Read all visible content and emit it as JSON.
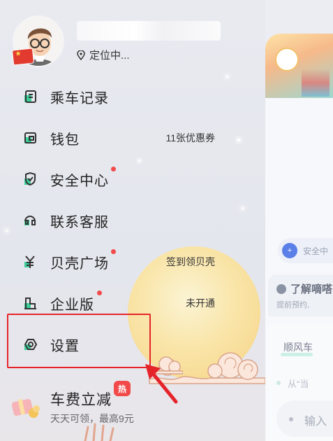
{
  "profile": {
    "location_text": "定位中..."
  },
  "menu": {
    "items": [
      {
        "label": "乘车记录",
        "extra": "",
        "badge": false
      },
      {
        "label": "钱包",
        "extra": "11张优惠券",
        "badge": false
      },
      {
        "label": "安全中心",
        "extra": "",
        "badge": true
      },
      {
        "label": "联系客服",
        "extra": "",
        "badge": false
      },
      {
        "label": "贝壳广场",
        "extra": "签到领贝壳",
        "badge": true
      },
      {
        "label": "企业版",
        "extra": "未开通",
        "badge": true
      },
      {
        "label": "设置",
        "extra": "",
        "badge": false
      }
    ]
  },
  "promo": {
    "title": "车费立减",
    "hot_badge": "热",
    "subtitle": "天天可领，最高9元"
  },
  "background": {
    "safety_text": "安全中",
    "learn_title": "了解嘀嗒",
    "learn_sub": "提前预约,",
    "ride_tab": "顺风车",
    "from_text": "从“当",
    "input_text": "输入"
  },
  "colors": {
    "accent_green": "#3ccf9a",
    "badge_red": "#f24a4a",
    "highlight_red": "#e5242a"
  },
  "icons": [
    "ride-record-icon",
    "wallet-icon",
    "safety-shield-icon",
    "customer-service-icon",
    "yen-icon",
    "enterprise-icon",
    "settings-icon",
    "location-pin-icon",
    "gift-icon",
    "arrow-icon"
  ]
}
